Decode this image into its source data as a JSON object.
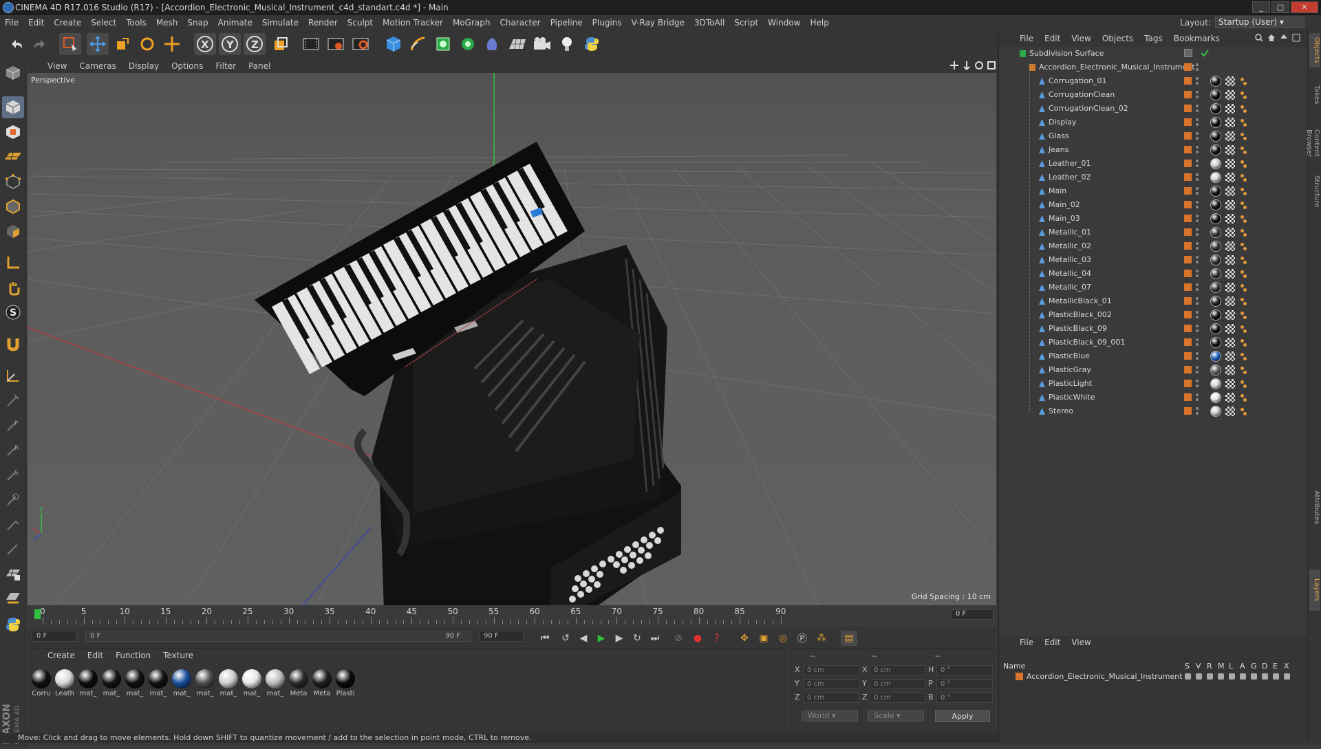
{
  "window": {
    "title": "CINEMA 4D R17.016 Studio (R17) - [Accordion_Electronic_Musical_Instrument_c4d_standart.c4d *] - Main"
  },
  "menubar": [
    "File",
    "Edit",
    "Create",
    "Select",
    "Tools",
    "Mesh",
    "Snap",
    "Animate",
    "Simulate",
    "Render",
    "Sculpt",
    "Motion Tracker",
    "MoGraph",
    "Character",
    "Pipeline",
    "Plugins",
    "V-Ray Bridge",
    "3DToAll",
    "Script",
    "Window",
    "Help"
  ],
  "layout": {
    "label": "Layout:",
    "value": "Startup (User)"
  },
  "viewport": {
    "menu": [
      "View",
      "Cameras",
      "Display",
      "Options",
      "Filter",
      "Panel"
    ],
    "camera_label": "Perspective",
    "grid_spacing": "Grid Spacing : 10 cm"
  },
  "timeline": {
    "ticks": [
      "0",
      "5",
      "10",
      "15",
      "20",
      "25",
      "30",
      "35",
      "40",
      "45",
      "50",
      "55",
      "60",
      "65",
      "70",
      "75",
      "80",
      "85",
      "90"
    ],
    "current_frame": "0 F",
    "start_field": "0 F",
    "range_start": "0 F",
    "range_end": "90 F",
    "end_field": "90 F"
  },
  "materials": {
    "menu": [
      "Create",
      "Edit",
      "Function",
      "Texture"
    ],
    "items": [
      {
        "label": "Corru",
        "color": "#111111"
      },
      {
        "label": "Leath",
        "color": "#d8d8d8"
      },
      {
        "label": "mat_",
        "color": "#0d0d0d"
      },
      {
        "label": "mat_",
        "color": "#141414"
      },
      {
        "label": "mat_",
        "color": "#101010"
      },
      {
        "label": "mat_",
        "color": "#121212"
      },
      {
        "label": "mat_",
        "color": "#1a4f9c"
      },
      {
        "label": "mat_",
        "color": "#505050"
      },
      {
        "label": "mat_",
        "color": "#cfcfcf"
      },
      {
        "label": "mat_",
        "color": "#e6e6e6"
      },
      {
        "label": "mat_",
        "color": "#bdbdbd"
      },
      {
        "label": "Meta",
        "color": "#2a2a2a"
      },
      {
        "label": "Meta",
        "color": "#1e1e1e"
      },
      {
        "label": "Plasti",
        "color": "#0a0a0a"
      }
    ]
  },
  "coordinates": {
    "headers": [
      "--",
      "--",
      "--"
    ],
    "rows": [
      {
        "a": "X",
        "a_val": "0 cm",
        "b": "X",
        "b_val": "0 cm",
        "c": "H",
        "c_val": "0 °"
      },
      {
        "a": "Y",
        "a_val": "0 cm",
        "b": "Y",
        "b_val": "0 cm",
        "c": "P",
        "c_val": "0 °"
      },
      {
        "a": "Z",
        "a_val": "0 cm",
        "b": "Z",
        "b_val": "0 cm",
        "c": "B",
        "c_val": "0 °"
      }
    ],
    "mode": "World",
    "size_mode": "Scale",
    "apply": "Apply"
  },
  "status": "Move: Click and drag to move elements. Hold down SHIFT to quantize movement / add to the selection in point mode, CTRL to remove.",
  "objects_panel": {
    "menu": [
      "File",
      "Edit",
      "View",
      "Objects",
      "Tags",
      "Bookmarks"
    ],
    "root": "Subdivision Surface",
    "group": "Accordion_Electronic_Musical_Instrument",
    "children": [
      {
        "name": "Corrugation_01",
        "tag": "#111111"
      },
      {
        "name": "CorrugationClean",
        "tag": "#111111"
      },
      {
        "name": "CorrugationClean_02",
        "tag": "#111111"
      },
      {
        "name": "Display",
        "tag": "#111111"
      },
      {
        "name": "Glass",
        "tag": "#111111"
      },
      {
        "name": "Jeans",
        "tag": "#111111"
      },
      {
        "name": "Leather_01",
        "tag": "#d0d0d0"
      },
      {
        "name": "Leather_02",
        "tag": "#d0d0d0"
      },
      {
        "name": "Main",
        "tag": "#111111"
      },
      {
        "name": "Main_02",
        "tag": "#111111"
      },
      {
        "name": "Main_03",
        "tag": "#111111"
      },
      {
        "name": "Metallic_01",
        "tag": "#333333"
      },
      {
        "name": "Metallic_02",
        "tag": "#333333"
      },
      {
        "name": "Metallic_03",
        "tag": "#333333"
      },
      {
        "name": "Metallic_04",
        "tag": "#333333"
      },
      {
        "name": "Metallic_07",
        "tag": "#333333"
      },
      {
        "name": "MetallicBlack_01",
        "tag": "#222222"
      },
      {
        "name": "PlasticBlack_002",
        "tag": "#111111"
      },
      {
        "name": "PlasticBlack_09",
        "tag": "#111111"
      },
      {
        "name": "PlasticBlack_09_001",
        "tag": "#111111"
      },
      {
        "name": "PlasticBlue",
        "tag": "#2060c0"
      },
      {
        "name": "PlasticGray",
        "tag": "#606060"
      },
      {
        "name": "PlasticLight",
        "tag": "#d8d8d8"
      },
      {
        "name": "PlasticWhite",
        "tag": "#e8e8e8"
      },
      {
        "name": "Stereo",
        "tag": "#cccccc"
      }
    ]
  },
  "layers_panel": {
    "menu": [
      "File",
      "Edit",
      "View"
    ],
    "header_name": "Name",
    "columns": [
      "S",
      "V",
      "R",
      "M",
      "L",
      "A",
      "G",
      "D",
      "E",
      "X"
    ],
    "row": "Accordion_Electronic_Musical_Instrument"
  },
  "side_tabs": [
    "Objects",
    "Takes",
    "Content Browser",
    "Structure",
    "Attributes",
    "Layers"
  ],
  "colors": {
    "accent": "#d9742a",
    "active_tool": "#5e6f86",
    "play_green": "#2fbf3a"
  }
}
